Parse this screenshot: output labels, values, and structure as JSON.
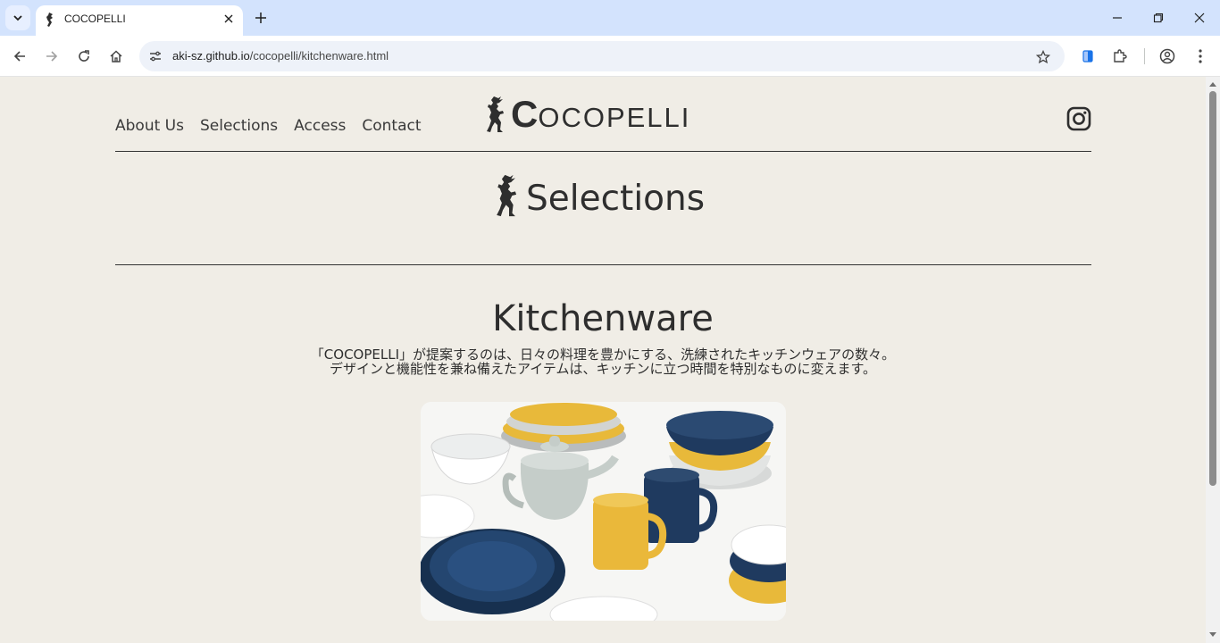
{
  "browser": {
    "tab_title": "COCOPELLI",
    "url_host": "aki-sz.github.io",
    "url_path": "/cocopelli/kitchenware.html"
  },
  "nav": {
    "items": [
      "About Us",
      "Selections",
      "Access",
      "Contact"
    ]
  },
  "logo": {
    "initial": "C",
    "rest": "OCOPELLI"
  },
  "section": {
    "title": "Selections"
  },
  "category": {
    "title": "Kitchenware",
    "description_line1": "「COCOPELLI」が提案するのは、日々の料理を豊かにする、洗練されたキッチンウェアの数々。",
    "description_line2": "デザインと機能性を兼ね備えたアイテムは、キッチンに立つ時間を特別なものに変えます。"
  },
  "colors": {
    "page_bg": "#f0ede6",
    "tabbar_bg": "#d3e3fd",
    "text": "#2e2e2e",
    "navy": "#1f3a5f",
    "mustard": "#e8b93a",
    "pale_grey": "#c9ccc9"
  },
  "icons": [
    "chevron-down-icon",
    "kokopelli-favicon",
    "close-icon",
    "plus-icon",
    "minimize-icon",
    "restore-icon",
    "back-icon",
    "forward-icon",
    "reload-icon",
    "home-icon",
    "site-info-icon",
    "star-icon",
    "reading-list-icon",
    "extensions-icon",
    "profile-icon",
    "menu-icon",
    "instagram-icon"
  ]
}
